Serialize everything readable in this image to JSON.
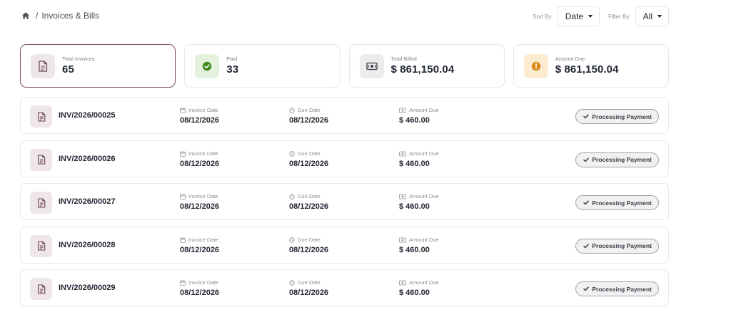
{
  "breadcrumb": {
    "home_icon": "home-icon",
    "separator": "/",
    "current": "Invoices & Bills"
  },
  "controls": {
    "sort_label": "Sort By:",
    "sort_value": "Date",
    "filter_label": "Filter By:",
    "filter_value": "All"
  },
  "stats": [
    {
      "label": "Total Invoices",
      "value": "65",
      "icon": "document-icon",
      "color": "#7c4f5c"
    },
    {
      "label": "Paid",
      "value": "33",
      "icon": "check-circle-icon",
      "color": "#3e8a1f"
    },
    {
      "label": "Total Billed",
      "value": "$ 861,150.04",
      "icon": "money-icon",
      "color": "#3a3f48"
    },
    {
      "label": "Amount Due",
      "value": "$ 861,150.04",
      "icon": "warning-circle-icon",
      "color": "#d98a10"
    }
  ],
  "field_labels": {
    "invoice_date": "Invoice Date",
    "due_date": "Due Date",
    "amount_due": "Amount Due"
  },
  "invoices": [
    {
      "id": "INV/2026/00025",
      "invoice_date": "08/12/2026",
      "due_date": "08/12/2026",
      "amount_due": "$ 460.00",
      "status": "Processing Payment"
    },
    {
      "id": "INV/2026/00026",
      "invoice_date": "08/12/2026",
      "due_date": "08/12/2026",
      "amount_due": "$ 460.00",
      "status": "Processing Payment"
    },
    {
      "id": "INV/2026/00027",
      "invoice_date": "08/12/2026",
      "due_date": "08/12/2026",
      "amount_due": "$ 460.00",
      "status": "Processing Payment"
    },
    {
      "id": "INV/2026/00028",
      "invoice_date": "08/12/2026",
      "due_date": "08/12/2026",
      "amount_due": "$ 460.00",
      "status": "Processing Payment"
    },
    {
      "id": "INV/2026/00029",
      "invoice_date": "08/12/2026",
      "due_date": "08/12/2026",
      "amount_due": "$ 460.00",
      "status": "Processing Payment"
    }
  ],
  "colors": {
    "accent": "#7c4f5c",
    "paid": "#3e8a1f",
    "due": "#d98a10"
  }
}
